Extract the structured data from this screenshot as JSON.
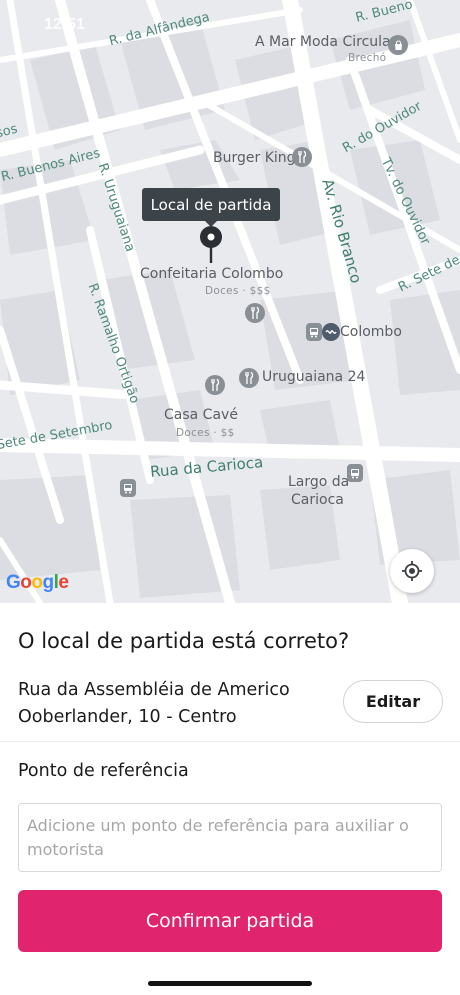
{
  "status_bar": {
    "time": "12:51"
  },
  "map": {
    "tooltip": "Local de partida",
    "attribution": "Google",
    "streets": {
      "alfandega": "R. da Alfândega",
      "buenos_aires": "R. Buenos Aires",
      "uruguaiana": "R. Uruguaiana",
      "ramalho": "R. Ramalho Ortigão",
      "sete_left": "Sete de Setembro",
      "carioca": "Rua da Carioca",
      "rio_branco": "Av. Rio Branco",
      "ouvidor": "R. do Ouvidor",
      "tv_ouvidor": "Tv. do Ouvidor",
      "sete_right": "R. Sete de Se",
      "buenos_top": "R. Bueno",
      "left_edge": "sos"
    },
    "pois": {
      "a_mar": {
        "name": "A Mar Moda Circular",
        "sub": "Brechó"
      },
      "burger_king": {
        "name": "Burger King"
      },
      "confeitaria": {
        "name": "Confeitaria Colombo",
        "sub": "Doces · $$$"
      },
      "colombo_station": {
        "name": "Colombo"
      },
      "uruguaiana24": {
        "name": "Uruguaiana 24"
      },
      "casa_cave": {
        "name": "Casa Cavé",
        "sub": "Doces · $$"
      },
      "largo": {
        "name": "Largo da Carioca",
        "line1": "Largo da",
        "line2": "Carioca"
      }
    },
    "icons": [
      "restaurant-icon",
      "shopping-bag-icon",
      "bus-icon",
      "tram-icon",
      "locate-me-icon",
      "pin-icon"
    ]
  },
  "sheet": {
    "question": "O local de partida está correto?",
    "address_line1": "Rua da Assembléia de Americo",
    "address_line2": "Ooberlander, 10 - Centro",
    "edit_label": "Editar",
    "reference_label": "Ponto de referência",
    "reference_placeholder": "Adicione um ponto de referência para auxiliar o motorista",
    "reference_value": "",
    "confirm_label": "Confirmar partida"
  },
  "colors": {
    "accent": "#e0246d",
    "tooltip_bg": "#3d4449",
    "map_bg": "#e9eaee",
    "street_label": "#4d8a79"
  }
}
